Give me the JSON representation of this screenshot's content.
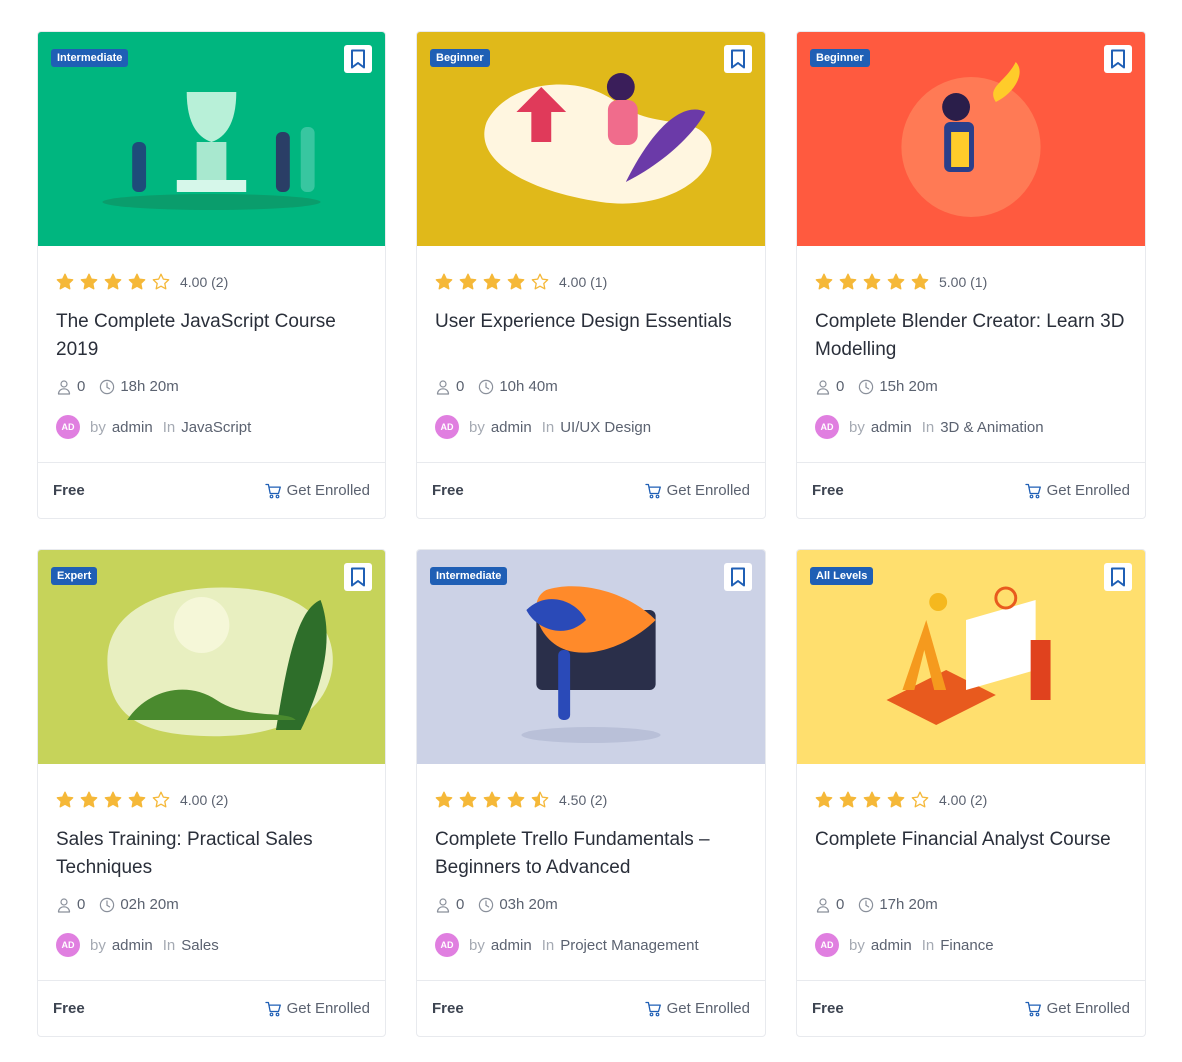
{
  "courses": [
    {
      "level": "Intermediate",
      "thumb_color": "#00b67f",
      "rating_value": 4,
      "rating_text": "4.00 (2)",
      "title": "The Complete JavaScript Course 2019",
      "students": "0",
      "duration": "18h 20m",
      "avatar": "AD",
      "by": "by",
      "author": "admin",
      "in": "In",
      "category": "JavaScript",
      "price": "Free",
      "enroll": "Get Enrolled"
    },
    {
      "level": "Beginner",
      "thumb_color": "#e0b91a",
      "rating_value": 4,
      "rating_text": "4.00 (1)",
      "title": "User Experience Design Essentials",
      "students": "0",
      "duration": "10h 40m",
      "avatar": "AD",
      "by": "by",
      "author": "admin",
      "in": "In",
      "category": "UI/UX Design",
      "price": "Free",
      "enroll": "Get Enrolled"
    },
    {
      "level": "Beginner",
      "thumb_color": "#ff5a3f",
      "rating_value": 5,
      "rating_text": "5.00 (1)",
      "title": "Complete Blender Creator: Learn 3D Modelling",
      "students": "0",
      "duration": "15h 20m",
      "avatar": "AD",
      "by": "by",
      "author": "admin",
      "in": "In",
      "category": "3D & Animation",
      "price": "Free",
      "enroll": "Get Enrolled"
    },
    {
      "level": "Expert",
      "thumb_color": "#c6d35a",
      "rating_value": 4,
      "rating_text": "4.00 (2)",
      "title": "Sales Training: Practical Sales Techniques",
      "students": "0",
      "duration": "02h 20m",
      "avatar": "AD",
      "by": "by",
      "author": "admin",
      "in": "In",
      "category": "Sales",
      "price": "Free",
      "enroll": "Get Enrolled"
    },
    {
      "level": "Intermediate",
      "thumb_color": "#ccd2e6",
      "rating_value": 4.5,
      "rating_text": "4.50 (2)",
      "title": "Complete Trello Fundamentals – Beginners to Advanced",
      "students": "0",
      "duration": "03h 20m",
      "avatar": "AD",
      "by": "by",
      "author": "admin",
      "in": "In",
      "category": "Project Management",
      "price": "Free",
      "enroll": "Get Enrolled"
    },
    {
      "level": "All Levels",
      "thumb_color": "#ffdf6e",
      "rating_value": 4,
      "rating_text": "4.00 (2)",
      "title": "Complete Financial Analyst Course",
      "students": "0",
      "duration": "17h 20m",
      "avatar": "AD",
      "by": "by",
      "author": "admin",
      "in": "In",
      "category": "Finance",
      "price": "Free",
      "enroll": "Get Enrolled"
    }
  ],
  "colors": {
    "level_badge": "#1f5fb5",
    "star": "#f5b838",
    "accent_blue": "#1f5fb5",
    "avatar": "#e07fe0"
  },
  "icons": {
    "bookmark": "bookmark-icon",
    "star": "star-icon",
    "user": "user-icon",
    "clock": "clock-icon",
    "cart": "cart-icon"
  }
}
